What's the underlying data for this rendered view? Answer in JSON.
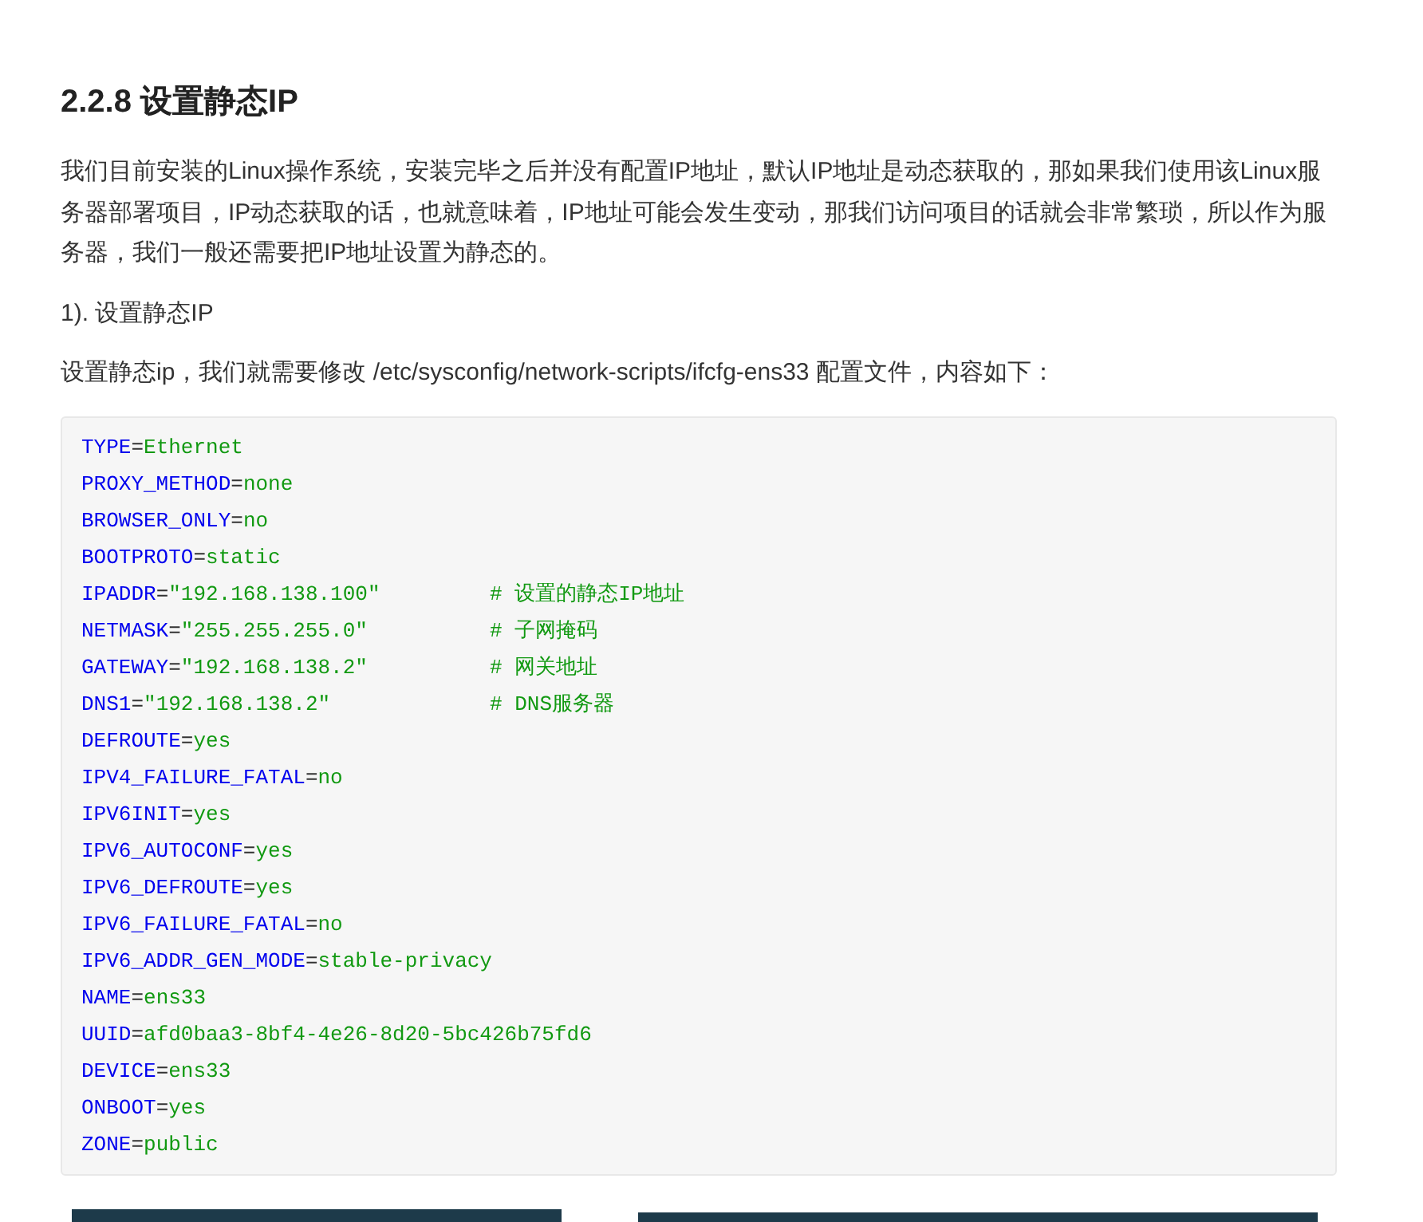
{
  "heading": "2.2.8 设置静态IP",
  "intro": "我们目前安装的Linux操作系统，安装完毕之后并没有配置IP地址，默认IP地址是动态获取的，那如果我们使用该Linux服务器部署项目，IP动态获取的话，也就意味着，IP地址可能会发生变动，那我们访问项目的话就会非常繁琐，所以作为服务器，我们一般还需要把IP地址设置为静态的。",
  "step": "1). 设置静态IP",
  "instruction": "设置静态ip，我们就需要修改 /etc/sysconfig/network-scripts/ifcfg-ens33 配置文件，内容如下：",
  "code_lines": [
    {
      "key": "TYPE",
      "sep": "=",
      "value": "Ethernet"
    },
    {
      "key": "PROXY_METHOD",
      "sep": "=",
      "value": "none"
    },
    {
      "key": "BROWSER_ONLY",
      "sep": "=",
      "value": "no"
    },
    {
      "key": "BOOTPROTO",
      "sep": "=",
      "value": "static"
    },
    {
      "key": "IPADDR",
      "sep": "=",
      "value": "\"192.168.138.100\"",
      "comment": "# 设置的静态IP地址"
    },
    {
      "key": "NETMASK",
      "sep": "=",
      "value": "\"255.255.255.0\"",
      "comment": "# 子网掩码"
    },
    {
      "key": "GATEWAY",
      "sep": "=",
      "value": "\"192.168.138.2\"",
      "comment": "# 网关地址"
    },
    {
      "key": "DNS1",
      "sep": "=",
      "value": "\"192.168.138.2\"",
      "comment": "# DNS服务器"
    },
    {
      "key": "DEFROUTE",
      "sep": "=",
      "value": "yes"
    },
    {
      "key": "IPV4_FAILURE_FATAL",
      "sep": "=",
      "value": "no"
    },
    {
      "key": "IPV6INIT",
      "sep": "=",
      "value": "yes"
    },
    {
      "key": "IPV6_AUTOCONF",
      "sep": "=",
      "value": "yes"
    },
    {
      "key": "IPV6_DEFROUTE",
      "sep": "=",
      "value": "yes"
    },
    {
      "key": "IPV6_FAILURE_FATAL",
      "sep": "=",
      "value": "no"
    },
    {
      "key": "IPV6_ADDR_GEN_MODE",
      "sep": "=",
      "value": "stable-privacy"
    },
    {
      "key": "NAME",
      "sep": "=",
      "value": "ens33"
    },
    {
      "key": "UUID",
      "sep": "=",
      "value": "afd0baa3-8bf4-4e26-8d20-5bc426b75fd6"
    },
    {
      "key": "DEVICE",
      "sep": "=",
      "value": "ens33"
    },
    {
      "key": "ONBOOT",
      "sep": "=",
      "value": "yes"
    },
    {
      "key": "ZONE",
      "sep": "=",
      "value": "public"
    }
  ]
}
